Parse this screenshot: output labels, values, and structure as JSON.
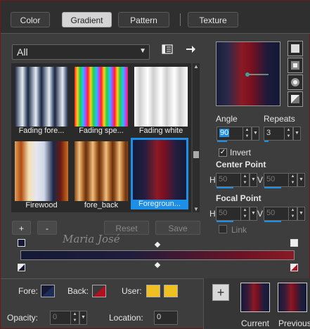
{
  "tabs": [
    {
      "label": "Color",
      "active": false
    },
    {
      "label": "Gradient",
      "active": true
    },
    {
      "label": "Pattern",
      "active": false
    },
    {
      "label": "Texture",
      "active": false
    }
  ],
  "category": {
    "value": "All"
  },
  "gradients": [
    {
      "label": "Fading fore..."
    },
    {
      "label": "Fading spe..."
    },
    {
      "label": "Fading white"
    },
    {
      "label": "Firewood"
    },
    {
      "label": "fore_back"
    },
    {
      "label": "Foregroun...",
      "selected": true
    }
  ],
  "buttons": {
    "add": "+",
    "remove": "-",
    "reset": "Reset",
    "save": "Save"
  },
  "angle": {
    "label": "Angle",
    "value": "90"
  },
  "repeats": {
    "label": "Repeats",
    "value": "3"
  },
  "invert": {
    "label": "Invert",
    "checked": true
  },
  "center_point": {
    "label": "Center Point",
    "h_label": "H",
    "h": "50",
    "v_label": "V",
    "v": "50"
  },
  "focal_point": {
    "label": "Focal Point",
    "h_label": "H",
    "h": "50",
    "v_label": "V",
    "v": "50"
  },
  "link": {
    "label": "Link",
    "checked": false
  },
  "watermark": "Maria José",
  "bottom": {
    "fore_label": "Fore:",
    "back_label": "Back:",
    "user_label": "User:",
    "opacity_label": "Opacity:",
    "opacity": "0",
    "location_label": "Location:",
    "location": "0",
    "current_label": "Current",
    "previous_label": "Previous"
  },
  "colors": {
    "accent": "#1e8fe6",
    "fore": "#141a36",
    "back": "#8a1a24",
    "user": "#f0c020"
  }
}
